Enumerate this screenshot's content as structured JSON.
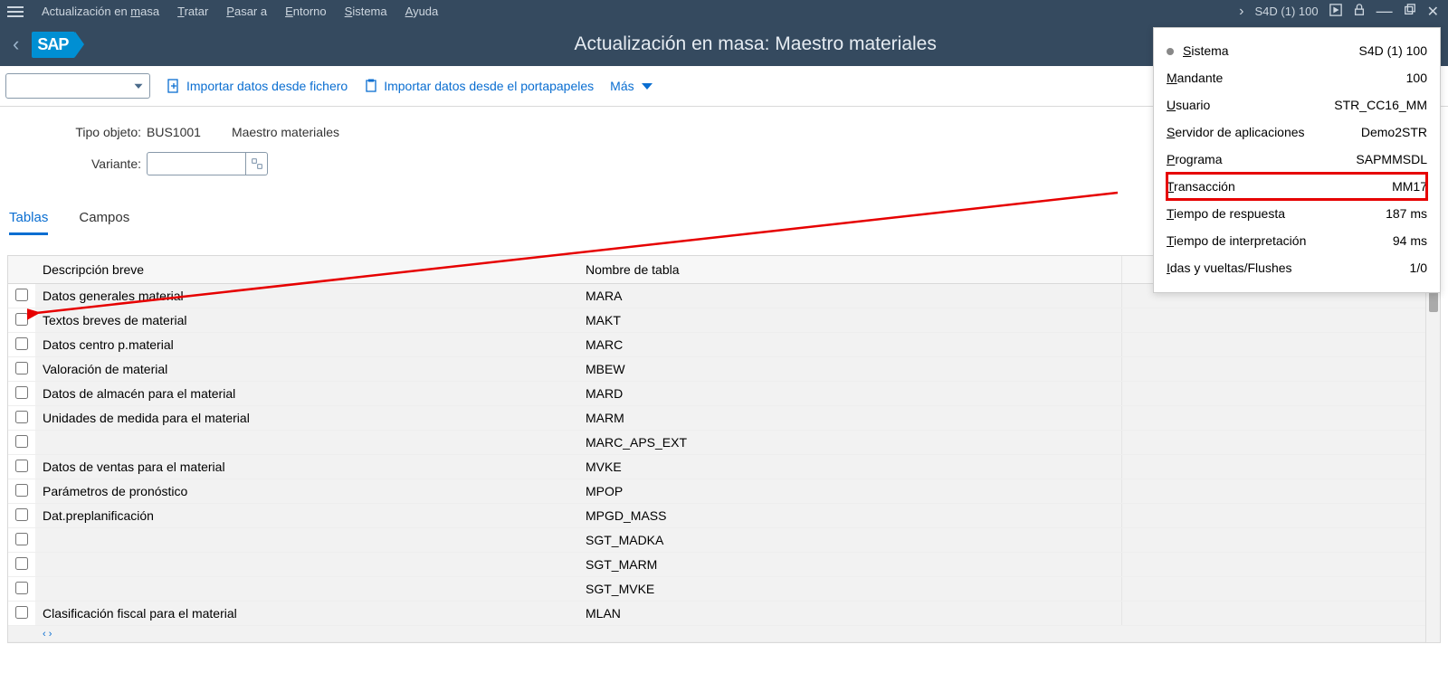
{
  "menubar": {
    "items": [
      {
        "label": "Actualización en masa",
        "accel": "m"
      },
      {
        "label": "Tratar",
        "accel": "T"
      },
      {
        "label": "Pasar a",
        "accel": "P"
      },
      {
        "label": "Entorno",
        "accel": "E"
      },
      {
        "label": "Sistema",
        "accel": "S"
      },
      {
        "label": "Ayuda",
        "accel": "A"
      }
    ],
    "system_label": "S4D (1) 100"
  },
  "titlebar": {
    "title": "Actualización en masa: Maestro materiales"
  },
  "toolbar": {
    "import_file": "Importar datos desde fichero",
    "import_clipboard": "Importar datos desde el portapapeles",
    "more": "Más"
  },
  "form": {
    "obj_type_label": "Tipo objeto:",
    "obj_type_value": "BUS1001",
    "obj_type_text": "Maestro materiales",
    "variant_label": "Variante:",
    "variant_value": ""
  },
  "tabs": [
    {
      "label": "Tablas",
      "active": true
    },
    {
      "label": "Campos",
      "active": false
    }
  ],
  "table": {
    "headers": {
      "desc": "Descripción breve",
      "name": "Nombre de tabla"
    },
    "rows": [
      {
        "desc": "Datos generales material",
        "name": "MARA"
      },
      {
        "desc": "Textos breves de material",
        "name": "MAKT"
      },
      {
        "desc": "Datos centro p.material",
        "name": "MARC"
      },
      {
        "desc": "Valoración de material",
        "name": "MBEW"
      },
      {
        "desc": "Datos de almacén para el material",
        "name": "MARD"
      },
      {
        "desc": "Unidades de medida para el material",
        "name": "MARM"
      },
      {
        "desc": "",
        "name": "MARC_APS_EXT"
      },
      {
        "desc": "Datos de ventas para el material",
        "name": "MVKE"
      },
      {
        "desc": "Parámetros de pronóstico",
        "name": "MPOP"
      },
      {
        "desc": "Dat.preplanificación",
        "name": "MPGD_MASS"
      },
      {
        "desc": "",
        "name": "SGT_MADKA"
      },
      {
        "desc": "",
        "name": "SGT_MARM"
      },
      {
        "desc": "",
        "name": "SGT_MVKE"
      },
      {
        "desc": "Clasificación fiscal para el material",
        "name": "MLAN"
      }
    ]
  },
  "statusinfo": {
    "rows": [
      {
        "label": "Sistema",
        "value": "S4D (1) 100",
        "bullet": true
      },
      {
        "label": "Mandante",
        "value": "100"
      },
      {
        "label": "Usuario",
        "value": "STR_CC16_MM"
      },
      {
        "label": "Servidor de aplicaciones",
        "value": "Demo2STR"
      },
      {
        "label": "Programa",
        "value": "SAPMMSDL"
      },
      {
        "label": "Transacción",
        "value": "MM17",
        "highlight": true
      },
      {
        "label": "Tiempo de respuesta",
        "value": "187 ms"
      },
      {
        "label": "Tiempo de interpretación",
        "value": "94 ms"
      },
      {
        "label": "Idas y vueltas/Flushes",
        "value": "1/0"
      }
    ]
  }
}
